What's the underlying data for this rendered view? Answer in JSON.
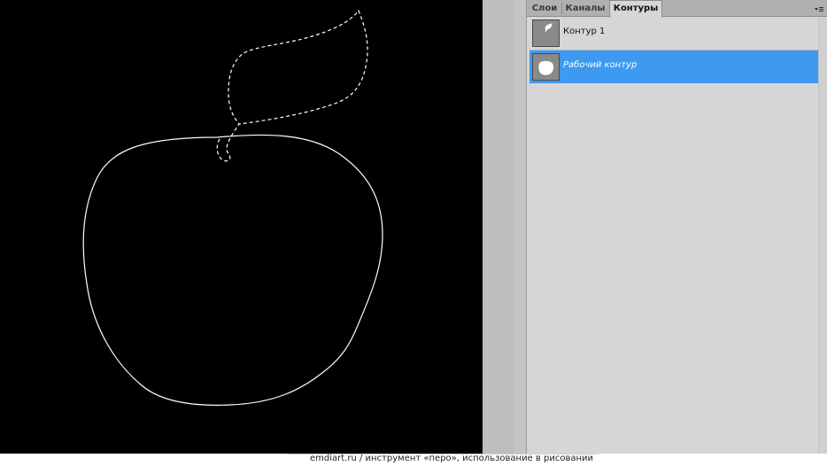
{
  "panel": {
    "tabs": [
      {
        "label": "Слои",
        "active": false
      },
      {
        "label": "Каналы",
        "active": false
      },
      {
        "label": "Контуры",
        "active": true
      }
    ],
    "menu_icon": "panel-menu-icon",
    "paths": [
      {
        "label": "Контур 1",
        "selected": false,
        "thumbnail": "leaf-path-thumbnail"
      },
      {
        "label": "Рабочий контур",
        "selected": true,
        "thumbnail": "apple-path-thumbnail"
      }
    ]
  },
  "canvas": {
    "background": "#000000",
    "content": "apple-outline-with-dashed-leaf-path"
  },
  "colors": {
    "selection": "#3d9af0",
    "panel_bg": "#d6d6d6",
    "canvas_bg": "#000000"
  },
  "footer": {
    "caption": "emdiart.ru  /  инструмент «перо»,  использование в рисовании"
  }
}
